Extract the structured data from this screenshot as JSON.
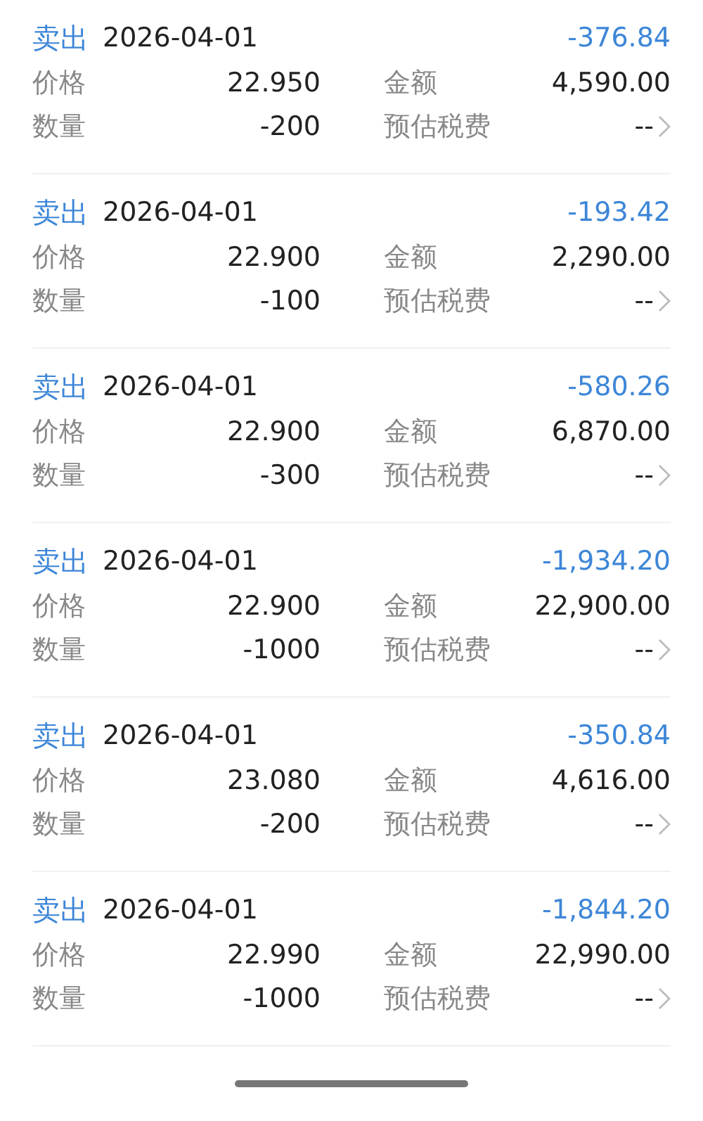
{
  "records": [
    {
      "kind": "sell",
      "side": "卖出",
      "date": "2026-04-01",
      "total": "-376.84",
      "price_label": "价格",
      "price": "22.950",
      "amount_label": "金额",
      "amount": "4,590.00",
      "qty_label": "数量",
      "qty": "-200",
      "fee_label": "预估税费",
      "fee": "--"
    },
    {
      "kind": "sell",
      "side": "卖出",
      "date": "2026-04-01",
      "total": "-193.42",
      "price_label": "价格",
      "price": "22.900",
      "amount_label": "金额",
      "amount": "2,290.00",
      "qty_label": "数量",
      "qty": "-100",
      "fee_label": "预估税费",
      "fee": "--"
    },
    {
      "kind": "sell",
      "side": "卖出",
      "date": "2026-04-01",
      "total": "-580.26",
      "price_label": "价格",
      "price": "22.900",
      "amount_label": "金额",
      "amount": "6,870.00",
      "qty_label": "数量",
      "qty": "-300",
      "fee_label": "预估税费",
      "fee": "--"
    },
    {
      "kind": "sell",
      "side": "卖出",
      "date": "2026-04-01",
      "total": "-1,934.20",
      "price_label": "价格",
      "price": "22.900",
      "amount_label": "金额",
      "amount": "22,900.00",
      "qty_label": "数量",
      "qty": "-1000",
      "fee_label": "预估税费",
      "fee": "--"
    },
    {
      "kind": "sell",
      "side": "卖出",
      "date": "2026-04-01",
      "total": "-350.84",
      "price_label": "价格",
      "price": "23.080",
      "amount_label": "金额",
      "amount": "4,616.00",
      "qty_label": "数量",
      "qty": "-200",
      "fee_label": "预估税费",
      "fee": "--"
    },
    {
      "kind": "sell",
      "side": "卖出",
      "date": "2026-04-01",
      "total": "-1,844.20",
      "price_label": "价格",
      "price": "22.990",
      "amount_label": "金额",
      "amount": "22,990.00",
      "qty_label": "数量",
      "qty": "-1000",
      "fee_label": "预估税费",
      "fee": "--"
    }
  ]
}
